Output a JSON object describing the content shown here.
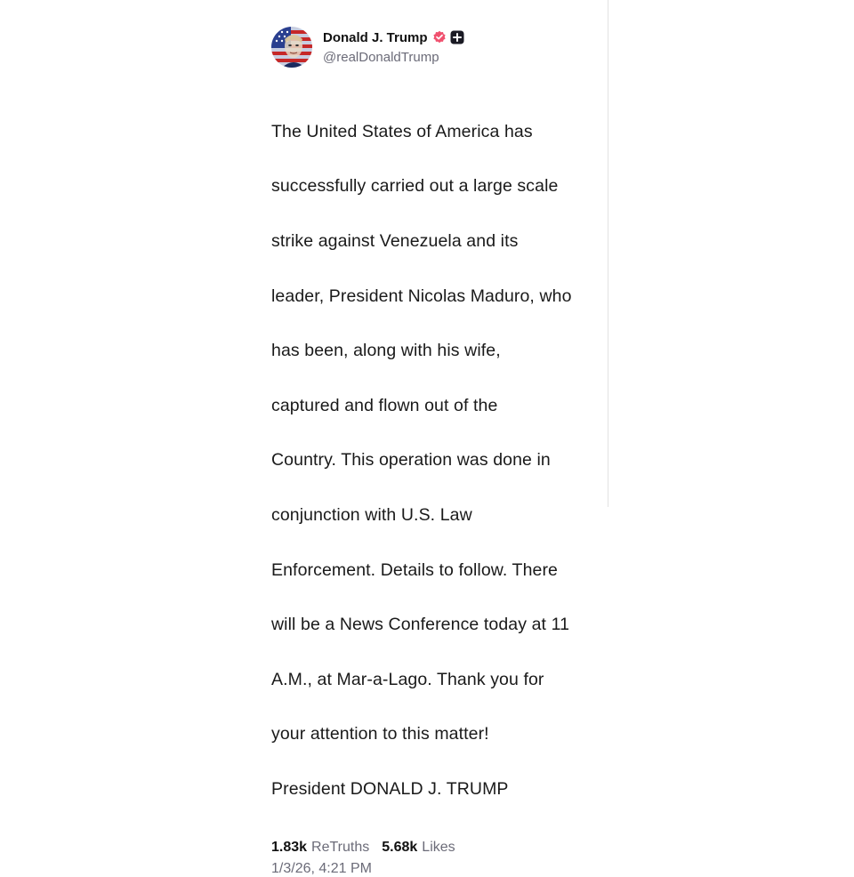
{
  "author": {
    "display_name": "Donald J. Trump",
    "handle": "@realDonaldTrump",
    "avatar_icon": "profile-photo",
    "verified_icon": "verified-badge-icon",
    "verified_color": "#f0506e",
    "plus_icon": "plus-badge-icon"
  },
  "post": {
    "lines": [
      "The United States of America has",
      "successfully carried out a large scale",
      "strike against Venezuela and its",
      "leader, President Nicolas Maduro, who",
      "has been, along with his wife,",
      "captured and flown out of the",
      "Country. This operation was done in",
      "conjunction with U.S. Law",
      "Enforcement. Details to follow. There",
      "will be a News Conference today at 11",
      "A.M., at Mar-a-Lago. Thank you for",
      "your attention to this matter!",
      "President DONALD J. TRUMP"
    ]
  },
  "stats": {
    "retruths_count": "1.83k",
    "retruths_label": "ReTruths",
    "likes_count": "5.68k",
    "likes_label": "Likes"
  },
  "timestamp": "1/3/26, 4:21 PM"
}
